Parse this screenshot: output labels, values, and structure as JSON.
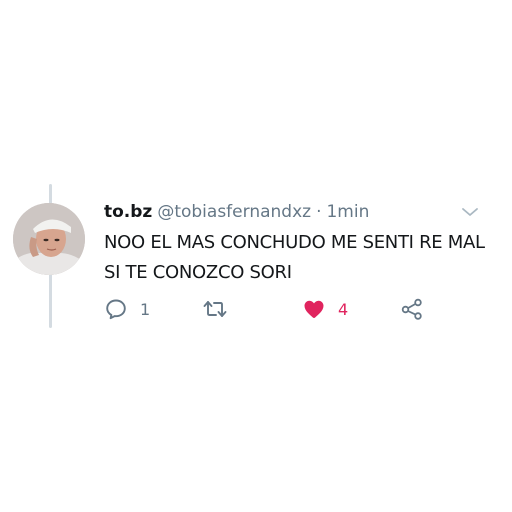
{
  "tweet": {
    "display_name": "to.bz",
    "handle": "@tobiasfernandxz",
    "separator": "·",
    "time": "1min",
    "text": "NOO EL MAS CONCHUDO ME SENTI RE MAL SI TE CONOZCO SORI",
    "avatar_icon": "avatar-photo"
  },
  "actions": {
    "reply_count": "1",
    "retweet_count": "",
    "like_count": "4",
    "like_color": "#e0245e",
    "icon_color": "#657786"
  }
}
